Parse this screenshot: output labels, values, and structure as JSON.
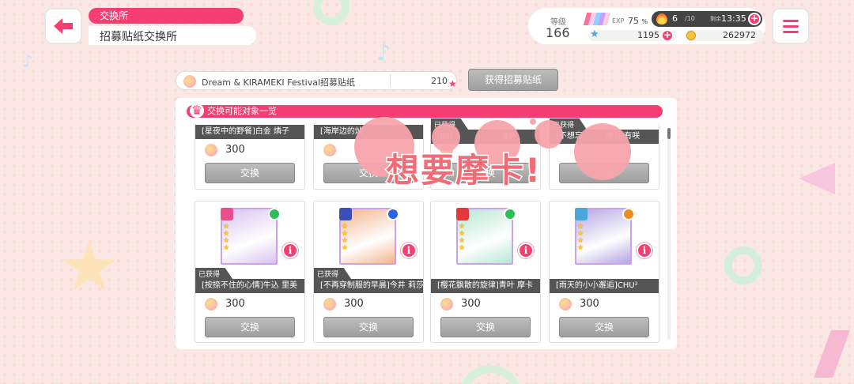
{
  "header": {
    "section_tag": "交换所",
    "page_title": "招募贴纸交换所"
  },
  "status": {
    "level_label": "等级",
    "level": "166",
    "exp_label": "EXP",
    "exp_percent": "75",
    "exp_unit": "%",
    "stamina_current": "6",
    "stamina_max": "/10",
    "remaining_label": "剩余",
    "timer": "13:35",
    "gems": "1195",
    "coins": "262972"
  },
  "ticket": {
    "name": "Dream & KIRAMEKI Festival招募贴纸",
    "count": "210",
    "get_button": "获得招募贴纸"
  },
  "list": {
    "header": "交换可能对象一览",
    "exchange_label": "交换",
    "owned_label": "已获得",
    "top_row": [
      {
        "name": "[星夜中的野餐]白金 燐子",
        "cost": "300",
        "owned": false
      },
      {
        "name": "[海岸边的灿",
        "cost": "",
        "owned": false
      },
      {
        "name": "[我们",
        "extra": "香澄",
        "cost": "",
        "owned": true
      },
      {
        "name": "[不想忘",
        "extra": "市谷 有咲",
        "cost": "",
        "owned": true
      }
    ],
    "cards": [
      {
        "name": "[按捺不住的心情]牛込 里美",
        "cost": "300",
        "owned": true,
        "band_color": "#e8508a",
        "attr_color": "#2ebd59",
        "stars": 4,
        "art": "#d8c3f0"
      },
      {
        "name": "[不再穿制服的早晨]今井 莉莎",
        "cost": "300",
        "owned": true,
        "band_color": "#3a4fb8",
        "attr_color": "#2a64e0",
        "stars": 4,
        "art": "#f3b58e"
      },
      {
        "name": "[樱花飘散的旋律]青叶 摩卡",
        "cost": "300",
        "owned": false,
        "band_color": "#e23a3a",
        "attr_color": "#2ebd59",
        "stars": 4,
        "art": "#b8e6d2"
      },
      {
        "name": "[雨天的小小邂逅]CHU²",
        "cost": "300",
        "owned": false,
        "band_color": "#4aa6d8",
        "attr_color": "#f08a22",
        "stars": 4,
        "art": "#b2a6e0"
      }
    ]
  },
  "overlay_text": "想要摩卡!"
}
